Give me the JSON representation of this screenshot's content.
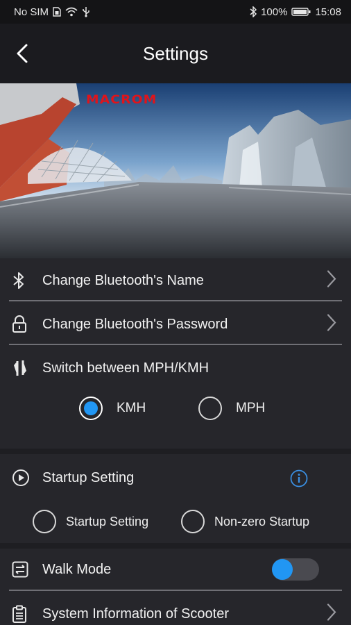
{
  "status_bar": {
    "carrier": "No SIM",
    "battery_percent": "100%",
    "time": "15:08"
  },
  "header": {
    "title": "Settings"
  },
  "banner": {
    "logo_text": "MACROM"
  },
  "settings": {
    "bluetooth_name": {
      "label": "Change Bluetooth's Name",
      "icon": "bluetooth-icon"
    },
    "bluetooth_password": {
      "label": "Change Bluetooth's Password",
      "icon": "lock-icon"
    },
    "unit_switch": {
      "label": "Switch between MPH/KMH",
      "icon": "swap-icon",
      "options": [
        "KMH",
        "MPH"
      ],
      "selected": "KMH"
    },
    "startup": {
      "label": "Startup Setting",
      "icon": "play-circle-icon",
      "options": [
        "Startup Setting",
        "Non-zero Startup"
      ],
      "selected": null
    },
    "walk_mode": {
      "label": "Walk Mode",
      "icon": "sliders-icon",
      "enabled": false
    },
    "system_info": {
      "label": "System Information of Scooter",
      "icon": "clipboard-icon"
    }
  },
  "colors": {
    "accent": "#2196f3",
    "background": "#1e1e22",
    "panel": "#26262b",
    "logo": "#e0141b"
  }
}
